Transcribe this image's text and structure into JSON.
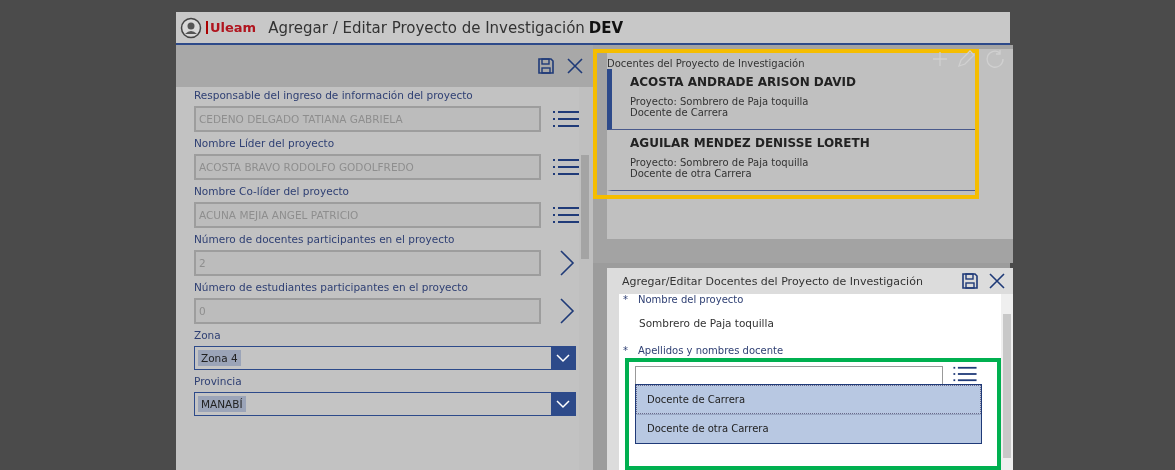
{
  "header": {
    "logo": "Uleam",
    "title": "Agregar / Editar Proyecto de Investigación",
    "env": "DEV"
  },
  "left_form": {
    "fields": [
      {
        "kind": "lookup",
        "label": "Responsable del ingreso de información del proyecto",
        "value": "CEDENO DELGADO TATIANA GABRIELA",
        "disabled": true
      },
      {
        "kind": "lookup",
        "label": "Nombre Líder del proyecto",
        "value": "ACOSTA BRAVO RODOLFO GODOLFREDO",
        "disabled": true
      },
      {
        "kind": "lookup",
        "label": "Nombre Co-líder del proyecto",
        "value": "ACUNA MEJIA ANGEL PATRICIO",
        "disabled": true
      },
      {
        "kind": "navigate",
        "label": "Número de docentes participantes en el proyecto",
        "value": "2",
        "disabled": true
      },
      {
        "kind": "navigate",
        "label": "Número de estudiantes participantes en el proyecto",
        "value": "0",
        "disabled": true
      },
      {
        "kind": "dropdown",
        "label": "Zona",
        "value": "Zona 4"
      },
      {
        "kind": "dropdown",
        "label": "Provincia",
        "value": "MANABÍ"
      }
    ]
  },
  "docentes_panel": {
    "title": "Docentes del Proyecto de Investigación",
    "items": [
      {
        "name": "ACOSTA ANDRADE ARISON DAVID",
        "project": "Proyecto: Sombrero de Paja toquilla",
        "type": "Docente de Carrera",
        "selected": true
      },
      {
        "name": "AGUILAR MENDEZ DENISSE LORETH",
        "project": "Proyecto: Sombrero de Paja toquilla",
        "type": "Docente de otra Carrera",
        "selected": false
      }
    ]
  },
  "edit_panel": {
    "title": "Agregar/Editar Docentes del Proyecto de Investigación",
    "project_label": "Nombre del proyecto",
    "required_mark": "*",
    "project_value": "Sombrero de Paja toquilla",
    "docente_label": "Apellidos y nombres docente",
    "options": [
      {
        "label": "Docente de Carrera",
        "selected": true
      },
      {
        "label": "Docente de otra Carrera",
        "selected": false
      }
    ]
  }
}
